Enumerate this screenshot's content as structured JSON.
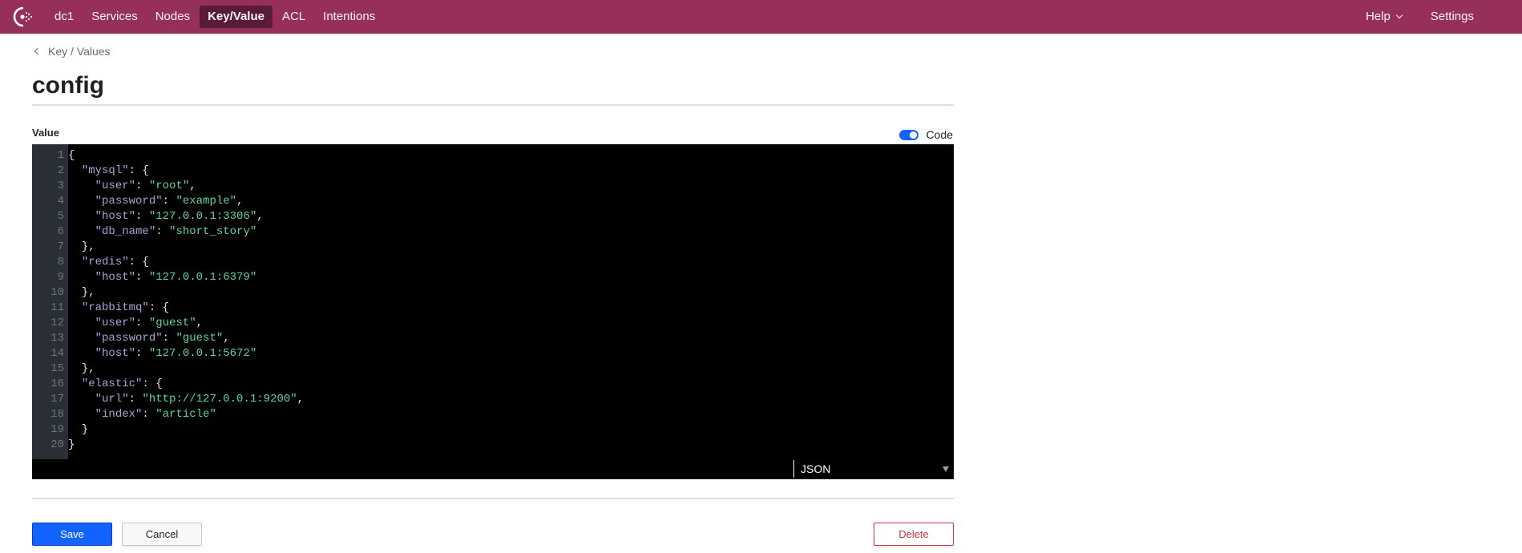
{
  "header": {
    "logo": "consul-logo-icon",
    "nav": [
      {
        "label": "dc1",
        "active": false
      },
      {
        "label": "Services",
        "active": false
      },
      {
        "label": "Nodes",
        "active": false
      },
      {
        "label": "Key/Value",
        "active": true
      },
      {
        "label": "ACL",
        "active": false
      },
      {
        "label": "Intentions",
        "active": false
      }
    ],
    "help_label": "Help",
    "settings_label": "Settings"
  },
  "breadcrumb": {
    "label": "Key / Values"
  },
  "page": {
    "title": "config"
  },
  "form": {
    "value_label": "Value",
    "code_toggle": {
      "label": "Code",
      "on": true
    },
    "editor": {
      "mode": "JSON",
      "lines": [
        [
          [
            "punc",
            "{"
          ]
        ],
        [
          [
            "punc",
            "  "
          ],
          [
            "key",
            "\"mysql\""
          ],
          [
            "punc",
            ": {"
          ]
        ],
        [
          [
            "punc",
            "    "
          ],
          [
            "key",
            "\"user\""
          ],
          [
            "punc",
            ": "
          ],
          [
            "str",
            "\"root\""
          ],
          [
            "punc",
            ","
          ]
        ],
        [
          [
            "punc",
            "    "
          ],
          [
            "key",
            "\"password\""
          ],
          [
            "punc",
            ": "
          ],
          [
            "str",
            "\"example\""
          ],
          [
            "punc",
            ","
          ]
        ],
        [
          [
            "punc",
            "    "
          ],
          [
            "key",
            "\"host\""
          ],
          [
            "punc",
            ": "
          ],
          [
            "str",
            "\"127.0.0.1:3306\""
          ],
          [
            "punc",
            ","
          ]
        ],
        [
          [
            "punc",
            "    "
          ],
          [
            "key",
            "\"db_name\""
          ],
          [
            "punc",
            ": "
          ],
          [
            "str",
            "\"short_story\""
          ]
        ],
        [
          [
            "punc",
            "  },"
          ]
        ],
        [
          [
            "punc",
            "  "
          ],
          [
            "key",
            "\"redis\""
          ],
          [
            "punc",
            ": {"
          ]
        ],
        [
          [
            "punc",
            "    "
          ],
          [
            "key",
            "\"host\""
          ],
          [
            "punc",
            ": "
          ],
          [
            "str",
            "\"127.0.0.1:6379\""
          ]
        ],
        [
          [
            "punc",
            "  },"
          ]
        ],
        [
          [
            "punc",
            "  "
          ],
          [
            "key",
            "\"rabbitmq\""
          ],
          [
            "punc",
            ": {"
          ]
        ],
        [
          [
            "punc",
            "    "
          ],
          [
            "key",
            "\"user\""
          ],
          [
            "punc",
            ": "
          ],
          [
            "str",
            "\"guest\""
          ],
          [
            "punc",
            ","
          ]
        ],
        [
          [
            "punc",
            "    "
          ],
          [
            "key",
            "\"password\""
          ],
          [
            "punc",
            ": "
          ],
          [
            "str",
            "\"guest\""
          ],
          [
            "punc",
            ","
          ]
        ],
        [
          [
            "punc",
            "    "
          ],
          [
            "key",
            "\"host\""
          ],
          [
            "punc",
            ": "
          ],
          [
            "str",
            "\"127.0.0.1:5672\""
          ]
        ],
        [
          [
            "punc",
            "  },"
          ]
        ],
        [
          [
            "punc",
            "  "
          ],
          [
            "key",
            "\"elastic\""
          ],
          [
            "punc",
            ": {"
          ]
        ],
        [
          [
            "punc",
            "    "
          ],
          [
            "key",
            "\"url\""
          ],
          [
            "punc",
            ": "
          ],
          [
            "str",
            "\"http://127.0.0.1:9200\""
          ],
          [
            "punc",
            ","
          ]
        ],
        [
          [
            "punc",
            "    "
          ],
          [
            "key",
            "\"index\""
          ],
          [
            "punc",
            ": "
          ],
          [
            "str",
            "\"article\""
          ]
        ],
        [
          [
            "punc",
            "  }"
          ]
        ],
        [
          [
            "punc",
            "}"
          ]
        ]
      ]
    },
    "save_label": "Save",
    "cancel_label": "Cancel",
    "delete_label": "Delete"
  },
  "colors": {
    "brand": "#962f5a",
    "nav_active": "#561a37",
    "primary": "#1563ff",
    "danger": "#c73445",
    "json_key": "#b59fd6",
    "json_string": "#5fd4a0"
  }
}
